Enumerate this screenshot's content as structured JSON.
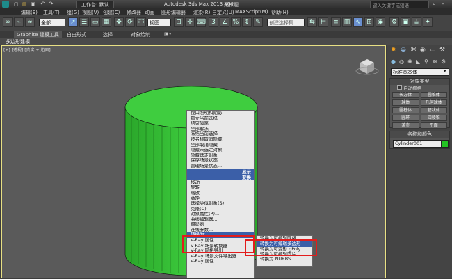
{
  "window": {
    "title": "Autodesk 3ds Max 2013 x64",
    "file": "无标题",
    "workspace_label": "工作台: 默认",
    "search_placeholder": "键入关键字或短语"
  },
  "menu": [
    "编辑(E)",
    "工具(T)",
    "组(G)",
    "视图(V)",
    "创建(C)",
    "修改器",
    "动画",
    "图形编辑器",
    "渲染(R)",
    "自定义(U)",
    "MAXScript(M)",
    "帮助(H)"
  ],
  "toolbar": {
    "filter_value": "全部",
    "view_value": "视图",
    "selection_set_placeholder": "创建选择集"
  },
  "ribbon": {
    "tabs": [
      "Graphite 建模工具",
      "自由形式",
      "选择",
      "对象绘制"
    ],
    "sub_label": "多边形建模"
  },
  "viewport": {
    "label": "[+] [透视] [真实 + 边面]",
    "object_color": "#3dbd3d"
  },
  "context_menu": {
    "items_top": [
      "孤立当前选择",
      "结束隔离",
      "全部解冻",
      "冻结当前选择",
      "按名称取消隐藏",
      "全部取消隐藏",
      "隐藏未选定对象",
      "隐藏选定对象",
      "保存场景状态...",
      "管理场景状态..."
    ],
    "section_display": "显示",
    "section_transform": "变换",
    "items_transform": [
      "移动",
      "旋转",
      "缩放",
      "选择",
      "选择类似对象(S)",
      "克隆(C)",
      "对象属性(P)...",
      "曲线编辑器...",
      "摄影表...",
      "连线参数...",
      "转换为:",
      "V-Ray 属性",
      "V-Ray 场景转换器",
      "V-Ray 网格导出",
      "V-Ray 场景文件导出器",
      "V-Ray 属性"
    ],
    "top_item": "视口照明和阴影"
  },
  "submenu": {
    "items": [
      "转换为可编辑网格",
      "转换为可编辑多边形",
      "转换为可变形 gPoly",
      "转换为可编辑面片",
      "转换为 NURBS"
    ],
    "highlighted": "转换为可编辑多边形"
  },
  "command_panel": {
    "dropdown": "标准基本体",
    "object_type_title": "对象类型",
    "autogrid": "自动栅格",
    "buttons": [
      "长方体",
      "圆锥体",
      "球体",
      "几何球体",
      "圆柱体",
      "管状体",
      "圆环",
      "四棱锥",
      "茶壶",
      "平面"
    ],
    "name_color_title": "名称和颜色",
    "object_name": "Cylinder001",
    "swatch_color": "#22c422"
  }
}
